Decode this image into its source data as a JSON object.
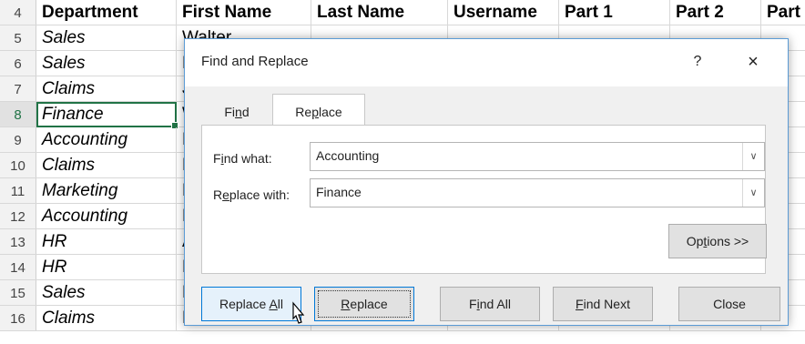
{
  "spreadsheet": {
    "header_row": {
      "num": "4",
      "cells": [
        "Department",
        "First Name",
        "Last Name",
        "Username",
        "Part 1",
        "Part 2",
        "Part"
      ]
    },
    "rows": [
      {
        "num": "5",
        "department": "Sales",
        "first": "Walter"
      },
      {
        "num": "6",
        "department": "Sales",
        "first": "H"
      },
      {
        "num": "7",
        "department": "Claims",
        "first": "Jo"
      },
      {
        "num": "8",
        "department": "Finance",
        "first": "W"
      },
      {
        "num": "9",
        "department": "Accounting",
        "first": "Lo"
      },
      {
        "num": "10",
        "department": "Claims",
        "first": "M"
      },
      {
        "num": "11",
        "department": "Marketing",
        "first": "M"
      },
      {
        "num": "12",
        "department": "Accounting",
        "first": "El"
      },
      {
        "num": "13",
        "department": "HR",
        "first": "A"
      },
      {
        "num": "14",
        "department": "HR",
        "first": "B"
      },
      {
        "num": "15",
        "department": "Sales",
        "first": "M"
      },
      {
        "num": "16",
        "department": "Claims",
        "first": "Maria"
      }
    ],
    "selected_cell_row": "8"
  },
  "dialog": {
    "title": "Find and Replace",
    "help": "?",
    "close_x": "×",
    "tabs": {
      "find": "Find",
      "replace": "Replace"
    },
    "find_what_label": "Find what:",
    "find_what_value": "Accounting",
    "replace_with_label": "Replace with:",
    "replace_with_value": "Finance",
    "options_button": "Options >>",
    "buttons": {
      "replace_all": "Replace All",
      "replace": "Replace",
      "find_all": "Find All",
      "find_next": "Find Next",
      "close": "Close"
    }
  },
  "icons": {
    "dropdown": "chevron-down-icon",
    "cursor": "mouse-pointer-icon"
  },
  "colors": {
    "selection": "#217346",
    "dialog_border": "#5b9bd5",
    "focus_border": "#0078d7"
  }
}
